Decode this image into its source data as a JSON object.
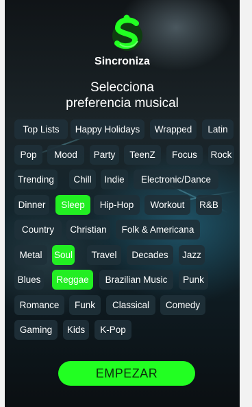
{
  "app": {
    "name": "Sincroniza"
  },
  "heading": {
    "line1": "Selecciona",
    "line2": "preferencia musical"
  },
  "genres": [
    [
      "Top Lists",
      "Happy Holidays",
      "Wrapped",
      "Latin"
    ],
    [
      "Pop",
      "Mood",
      "Party",
      "TeenZ",
      "Focus",
      "Rock"
    ],
    [
      "Trending",
      "Chill",
      "Indie",
      "Electronic/Dance"
    ],
    [
      "Dinner",
      "Sleep",
      "Hip-Hop",
      "Workout",
      "R&B"
    ],
    [
      "Country",
      "Christian",
      "Folk & Americana"
    ],
    [
      "Metal",
      "Soul",
      "Travel",
      "Decades",
      "Jazz"
    ],
    [
      "Blues",
      "Reggae",
      "Brazilian Music",
      "Punk"
    ],
    [
      "Romance",
      "Funk",
      "Classical",
      "Comedy"
    ],
    [
      "Gaming",
      "Kids",
      "K-Pop"
    ]
  ],
  "selected": [
    "Sleep",
    "Soul",
    "Reggae"
  ],
  "start_button": {
    "label": "EMPEZAR"
  },
  "colors": {
    "accent": "#22ff22",
    "tag_bg": "#1e3038",
    "background": "#0e1a20"
  }
}
